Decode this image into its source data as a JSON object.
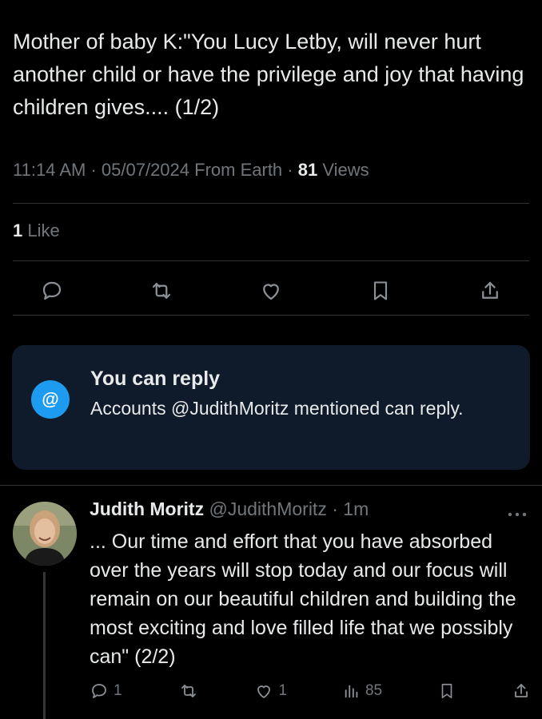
{
  "tweet": {
    "text": "Mother of baby K:\"You Lucy Letby, will never hurt another child or have the privilege and joy that having children gives.... (1/2)",
    "time": "11:14 AM",
    "date": "05/07/2024",
    "source": "From Earth",
    "views_count": "81",
    "views_label": "Views",
    "likes_count": "1",
    "likes_label": "Like"
  },
  "reply_restriction": {
    "title": "You can reply",
    "body": "Accounts @JudithMoritz mentioned can reply.",
    "icon_glyph": "@"
  },
  "reply": {
    "name": "Judith Moritz",
    "handle": "@JudithMoritz",
    "time": "1m",
    "text": "... Our time and effort that you have absorbed over the years will stop today and our focus will remain on our beautiful children and building the most exciting and love filled life that we possibly can\" (2/2)",
    "replies": "1",
    "likes": "1",
    "views": "85"
  },
  "colors": {
    "background": "#000000",
    "text": "#e7e9ea",
    "muted": "#71767b",
    "accent": "#1d9bf0",
    "card": "#0f1b2a"
  },
  "icons": [
    "reply-icon",
    "retweet-icon",
    "like-icon",
    "bookmark-icon",
    "share-icon",
    "more-icon",
    "views-icon",
    "at-icon"
  ]
}
